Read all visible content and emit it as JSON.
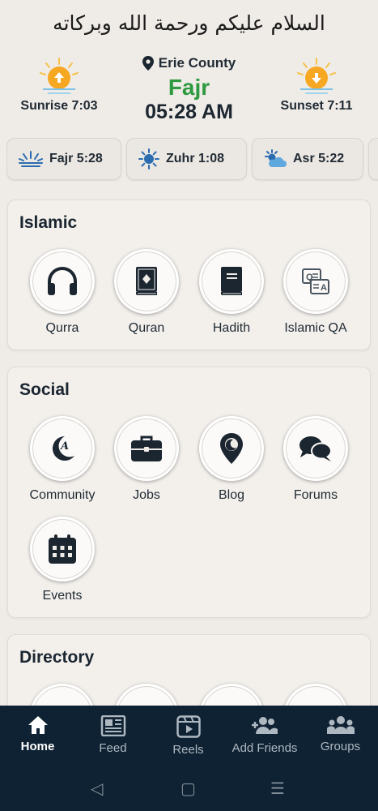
{
  "greeting": "السلام عليكم ورحمة الله وبركاته",
  "header": {
    "sunrise_label": "Sunrise 7:03",
    "sunset_label": "Sunset 7:11",
    "location": "Erie County",
    "current_prayer": "Fajr",
    "current_time": "05:28 AM",
    "accent_color": "#2e9a3f"
  },
  "prayer_pills": [
    {
      "label": "Fajr 5:28",
      "icon": "sunrise-lines-icon"
    },
    {
      "label": "Zuhr 1:08",
      "icon": "sun-icon"
    },
    {
      "label": "Asr 5:22",
      "icon": "sun-cloud-icon"
    }
  ],
  "sections": {
    "islamic": {
      "title": "Islamic",
      "items": [
        {
          "label": "Qurra",
          "icon": "headphones-icon"
        },
        {
          "label": "Quran",
          "icon": "quran-book-icon"
        },
        {
          "label": "Hadith",
          "icon": "book-icon"
        },
        {
          "label": "Islamic QA",
          "icon": "qa-icon"
        }
      ]
    },
    "social": {
      "title": "Social",
      "items": [
        {
          "label": "Community",
          "icon": "crescent-icon"
        },
        {
          "label": "Jobs",
          "icon": "briefcase-icon"
        },
        {
          "label": "Blog",
          "icon": "map-pin-icon"
        },
        {
          "label": "Forums",
          "icon": "chat-bubbles-icon"
        },
        {
          "label": "Events",
          "icon": "calendar-icon"
        }
      ]
    },
    "directory": {
      "title": "Directory"
    }
  },
  "bottom_nav": [
    {
      "label": "Home",
      "icon": "home-icon",
      "active": true
    },
    {
      "label": "Feed",
      "icon": "newspaper-icon"
    },
    {
      "label": "Reels",
      "icon": "reels-icon"
    },
    {
      "label": "Add Friends",
      "icon": "add-friends-icon"
    },
    {
      "label": "Groups",
      "icon": "groups-icon"
    }
  ],
  "system_nav": {
    "back": "◁",
    "home": "▢",
    "recents": "☰"
  }
}
